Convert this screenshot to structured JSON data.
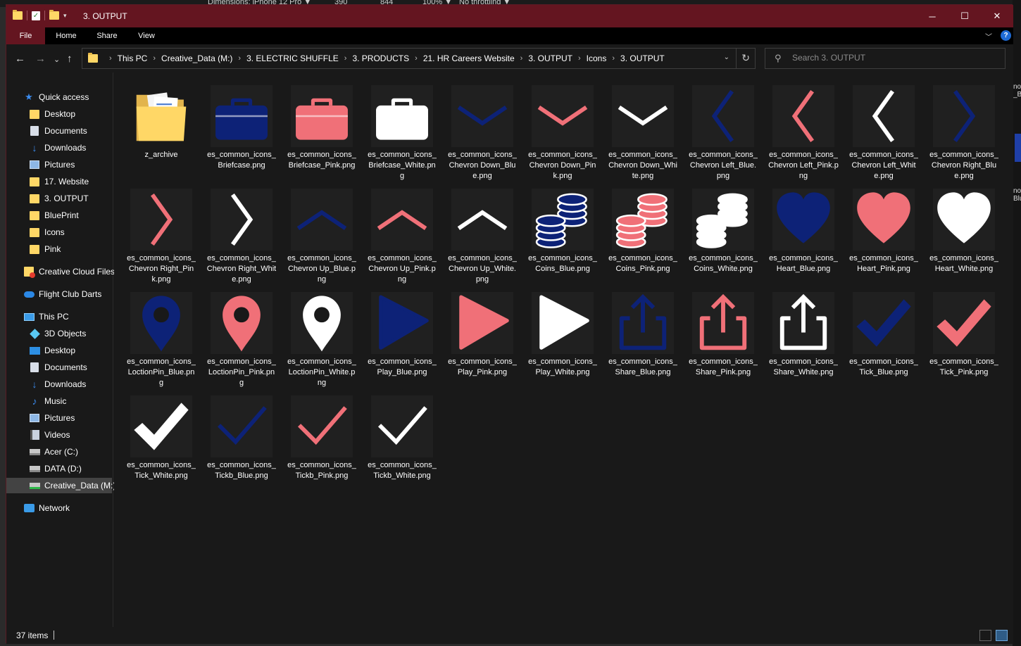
{
  "background_app": {
    "device_label": "Dimensions: iPhone 12 Pro ▼",
    "width_value": "390",
    "height_value": "844",
    "zoom": "100% ▼",
    "throttle": "No throttling ▼",
    "right_edge_text_1": "no _B",
    "right_edge_text_2": "no Blu"
  },
  "window": {
    "title": "3. OUTPUT",
    "minimize": "─",
    "maximize": "☐",
    "close": "✕"
  },
  "ribbon": {
    "tabs": [
      "File",
      "Home",
      "Share",
      "View"
    ],
    "expand_icon": "﹀",
    "help": "?"
  },
  "nav": {
    "back": "←",
    "forward": "→",
    "recent": "⌄",
    "up": "↑",
    "path_arrow": "›",
    "breadcrumbs": [
      "This PC",
      "Creative_Data (M:)",
      "3. ELECTRIC SHUFFLE",
      "3. PRODUCTS",
      "21. HR Careers Website",
      "3. OUTPUT",
      "Icons",
      "3. OUTPUT"
    ],
    "dropdown": "⌄",
    "refresh": "↻",
    "search_icon": "⚲",
    "search_placeholder": "Search 3. OUTPUT"
  },
  "sidebar": {
    "items": [
      {
        "label": "Quick access",
        "icon": "star-icon",
        "pinned": false
      },
      {
        "label": "Desktop",
        "icon": "folder-icon",
        "pinned": true
      },
      {
        "label": "Documents",
        "icon": "documents-icon",
        "pinned": true
      },
      {
        "label": "Downloads",
        "icon": "downloads-icon",
        "pinned": true
      },
      {
        "label": "Pictures",
        "icon": "pictures-icon",
        "pinned": true
      },
      {
        "label": "17. Website",
        "icon": "folder-icon",
        "pinned": true
      },
      {
        "label": "3. OUTPUT",
        "icon": "folder-icon",
        "pinned": false
      },
      {
        "label": "BluePrint",
        "icon": "folder-icon",
        "pinned": false
      },
      {
        "label": "Icons",
        "icon": "folder-icon",
        "pinned": false
      },
      {
        "label": "Pink",
        "icon": "folder-icon",
        "pinned": false
      },
      {
        "label": "Creative Cloud Files",
        "icon": "creative-cloud-icon",
        "pinned": false
      },
      {
        "label": "Flight Club Darts",
        "icon": "onedrive-icon",
        "pinned": false
      },
      {
        "label": "This PC",
        "icon": "this-pc-icon",
        "pinned": false
      },
      {
        "label": "3D Objects",
        "icon": "3d-objects-icon",
        "pinned": false
      },
      {
        "label": "Desktop",
        "icon": "desktop-icon",
        "pinned": false
      },
      {
        "label": "Documents",
        "icon": "documents-icon",
        "pinned": false
      },
      {
        "label": "Downloads",
        "icon": "downloads-icon",
        "pinned": false
      },
      {
        "label": "Music",
        "icon": "music-icon",
        "pinned": false
      },
      {
        "label": "Pictures",
        "icon": "pictures-icon",
        "pinned": false
      },
      {
        "label": "Videos",
        "icon": "videos-icon",
        "pinned": false
      },
      {
        "label": "Acer (C:)",
        "icon": "drive-icon",
        "pinned": false
      },
      {
        "label": "DATA (D:)",
        "icon": "drive-icon",
        "pinned": false
      },
      {
        "label": "Creative_Data (M:)",
        "icon": "network-drive-icon",
        "pinned": false
      },
      {
        "label": "Network",
        "icon": "network-icon",
        "pinned": false
      }
    ],
    "pin_glyph": "📌"
  },
  "colors": {
    "blue": "#0d2277",
    "pink": "#f07078",
    "white": "#ffffff",
    "title_bar": "#641520"
  },
  "files": [
    {
      "name": "z_archive",
      "icon": "folder",
      "color": "folder"
    },
    {
      "name": "es_common_icons_Briefcase.png",
      "icon": "briefcase",
      "color": "blue"
    },
    {
      "name": "es_common_icons_Briefcase_Pink.png",
      "icon": "briefcase",
      "color": "pink"
    },
    {
      "name": "es_common_icons_Briefcase_White.png",
      "icon": "briefcase",
      "color": "white"
    },
    {
      "name": "es_common_icons_Chevron Down_Blue.png",
      "icon": "chevron-down",
      "color": "blue"
    },
    {
      "name": "es_common_icons_Chevron Down_Pink.png",
      "icon": "chevron-down",
      "color": "pink"
    },
    {
      "name": "es_common_icons_Chevron Down_White.png",
      "icon": "chevron-down",
      "color": "white"
    },
    {
      "name": "es_common_icons_Chevron Left_Blue.png",
      "icon": "chevron-left",
      "color": "blue"
    },
    {
      "name": "es_common_icons_Chevron Left_Pink.png",
      "icon": "chevron-left",
      "color": "pink"
    },
    {
      "name": "es_common_icons_Chevron Left_White.png",
      "icon": "chevron-left",
      "color": "white"
    },
    {
      "name": "es_common_icons_Chevron Right_Blue.png",
      "icon": "chevron-right",
      "color": "blue"
    },
    {
      "name": "es_common_icons_Chevron Right_Pink.png",
      "icon": "chevron-right",
      "color": "pink"
    },
    {
      "name": "es_common_icons_Chevron Right_White.png",
      "icon": "chevron-right",
      "color": "white"
    },
    {
      "name": "es_common_icons_Chevron Up_Blue.png",
      "icon": "chevron-up",
      "color": "blue"
    },
    {
      "name": "es_common_icons_Chevron Up_Pink.png",
      "icon": "chevron-up",
      "color": "pink"
    },
    {
      "name": "es_common_icons_Chevron Up_White.png",
      "icon": "chevron-up",
      "color": "white"
    },
    {
      "name": "es_common_icons_Coins_Blue.png",
      "icon": "coins",
      "color": "blue"
    },
    {
      "name": "es_common_icons_Coins_Pink.png",
      "icon": "coins",
      "color": "pink"
    },
    {
      "name": "es_common_icons_Coins_White.png",
      "icon": "coins",
      "color": "white"
    },
    {
      "name": "es_common_icons_Heart_Blue.png",
      "icon": "heart",
      "color": "blue"
    },
    {
      "name": "es_common_icons_Heart_Pink.png",
      "icon": "heart",
      "color": "pink"
    },
    {
      "name": "es_common_icons_Heart_White.png",
      "icon": "heart",
      "color": "white"
    },
    {
      "name": "es_common_icons_LoctionPin_Blue.png",
      "icon": "pin",
      "color": "blue"
    },
    {
      "name": "es_common_icons_LoctionPin_Pink.png",
      "icon": "pin",
      "color": "pink"
    },
    {
      "name": "es_common_icons_LoctionPin_White.png",
      "icon": "pin",
      "color": "white"
    },
    {
      "name": "es_common_icons_Play_Blue.png",
      "icon": "play",
      "color": "blue"
    },
    {
      "name": "es_common_icons_Play_Pink.png",
      "icon": "play",
      "color": "pink"
    },
    {
      "name": "es_common_icons_Play_White.png",
      "icon": "play",
      "color": "white"
    },
    {
      "name": "es_common_icons_Share_Blue.png",
      "icon": "share",
      "color": "blue"
    },
    {
      "name": "es_common_icons_Share_Pink.png",
      "icon": "share",
      "color": "pink"
    },
    {
      "name": "es_common_icons_Share_White.png",
      "icon": "share",
      "color": "white"
    },
    {
      "name": "es_common_icons_Tick_Blue.png",
      "icon": "tick",
      "color": "blue"
    },
    {
      "name": "es_common_icons_Tick_Pink.png",
      "icon": "tick",
      "color": "pink"
    },
    {
      "name": "es_common_icons_Tick_White.png",
      "icon": "tick",
      "color": "white"
    },
    {
      "name": "es_common_icons_Tickb_Blue.png",
      "icon": "tickb",
      "color": "blue"
    },
    {
      "name": "es_common_icons_Tickb_Pink.png",
      "icon": "tickb",
      "color": "pink"
    },
    {
      "name": "es_common_icons_Tickb_White.png",
      "icon": "tickb",
      "color": "white"
    }
  ],
  "status": {
    "item_count": "37 items"
  }
}
